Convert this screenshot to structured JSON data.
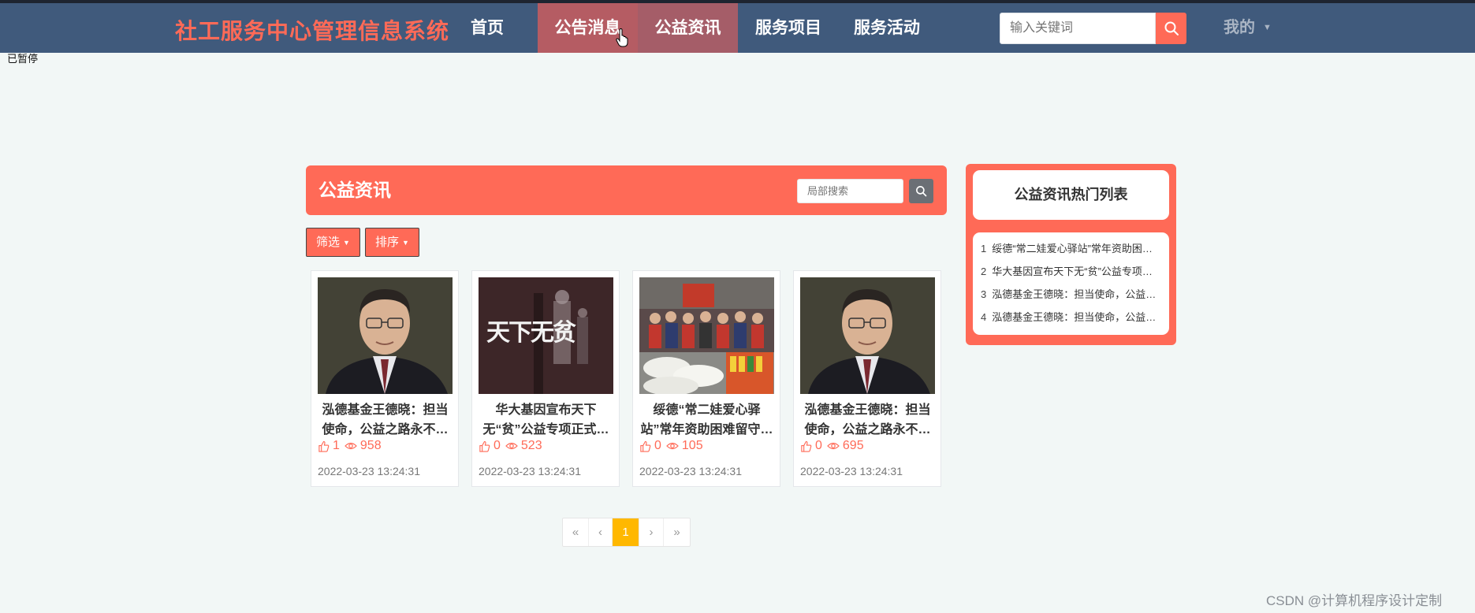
{
  "app": {
    "brand": "社工服务中心管理信息系统",
    "paused_label": "已暂停"
  },
  "nav": {
    "items": [
      {
        "label": "首页"
      },
      {
        "label": "公告消息"
      },
      {
        "label": "公益资讯"
      },
      {
        "label": "服务项目"
      },
      {
        "label": "服务活动"
      }
    ],
    "search_placeholder": "输入关键词",
    "mine_label": "我的"
  },
  "main": {
    "title": "公益资讯",
    "local_search_placeholder": "局部搜索",
    "filter_label": "筛选",
    "sort_label": "排序",
    "cards": [
      {
        "title": "泓德基金王德晓：担当使命，公益之路永不停歇",
        "likes": "1",
        "views": "958",
        "date": "2022-03-23 13:24:31",
        "image": "portrait"
      },
      {
        "title": "华大基因宣布天下无“贫”公益专项正式启动",
        "likes": "0",
        "views": "523",
        "date": "2022-03-23 13:24:31",
        "image": "poster"
      },
      {
        "title": "绥德“常二娃爱心驿站”常年资助困难留守儿童",
        "likes": "0",
        "views": "105",
        "date": "2022-03-23 13:24:31",
        "image": "crowd"
      },
      {
        "title": "泓德基金王德晓：担当使命，公益之路永不停歇",
        "likes": "0",
        "views": "695",
        "date": "2022-03-23 13:24:31",
        "image": "portrait"
      }
    ],
    "poster_text": "天下无贫"
  },
  "pagination": {
    "first": "«",
    "prev": "‹",
    "current": "1",
    "next": "›",
    "last": "»"
  },
  "sidebar": {
    "title": "公益资讯热门列表",
    "items": [
      {
        "num": "1",
        "label": "绥德“常二娃爱心驿站”常年资助困难留守儿童"
      },
      {
        "num": "2",
        "label": "华大基因宣布天下无“贫”公益专项正式启动"
      },
      {
        "num": "3",
        "label": "泓德基金王德晓：担当使命，公益之路永不停歇"
      },
      {
        "num": "4",
        "label": "泓德基金王德晓：担当使命，公益之路永不停歇"
      }
    ]
  },
  "watermark": "CSDN @计算机程序设计定制",
  "colors": {
    "navbar": "#405a7c",
    "accent": "#ff6a57",
    "pager_current": "#ffb800",
    "background": "#f2f7f6"
  }
}
